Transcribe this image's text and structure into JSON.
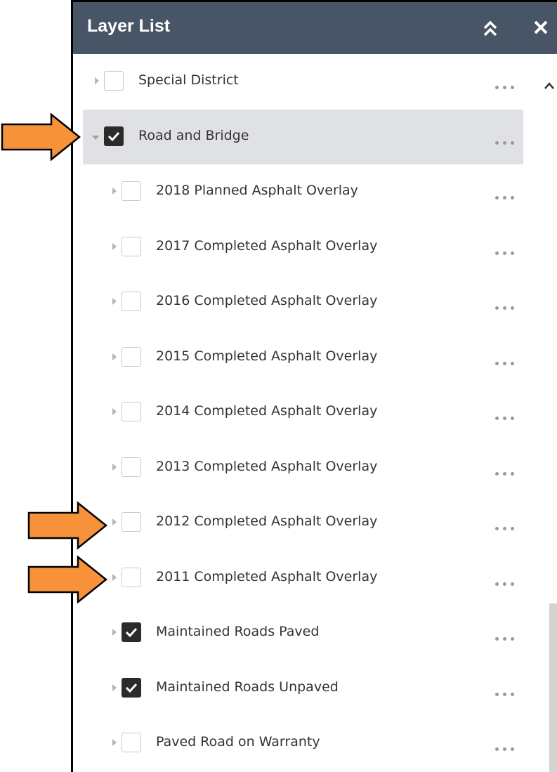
{
  "panel": {
    "title": "Layer List",
    "collapse_icon": "double-chevron-up-icon",
    "close_icon": "close-icon"
  },
  "layers": [
    {
      "label": "Special District",
      "checked": false,
      "expanded": false,
      "level": 0
    },
    {
      "label": "Road and Bridge",
      "checked": true,
      "expanded": true,
      "level": 0,
      "selected": true
    },
    {
      "label": "2018 Planned Asphalt Overlay",
      "checked": false,
      "expanded": false,
      "level": 1
    },
    {
      "label": "2017 Completed Asphalt Overlay",
      "checked": false,
      "expanded": false,
      "level": 1
    },
    {
      "label": "2016 Completed Asphalt Overlay",
      "checked": false,
      "expanded": false,
      "level": 1
    },
    {
      "label": "2015 Completed Asphalt Overlay",
      "checked": false,
      "expanded": false,
      "level": 1
    },
    {
      "label": "2014 Completed Asphalt Overlay",
      "checked": false,
      "expanded": false,
      "level": 1
    },
    {
      "label": "2013 Completed Asphalt Overlay",
      "checked": false,
      "expanded": false,
      "level": 1
    },
    {
      "label": "2012 Completed Asphalt Overlay",
      "checked": false,
      "expanded": false,
      "level": 1
    },
    {
      "label": "2011 Completed Asphalt Overlay",
      "checked": false,
      "expanded": false,
      "level": 1
    },
    {
      "label": "Maintained Roads Paved",
      "checked": true,
      "expanded": false,
      "level": 1
    },
    {
      "label": "Maintained Roads Unpaved",
      "checked": true,
      "expanded": false,
      "level": 1
    },
    {
      "label": "Paved Road on Warranty",
      "checked": false,
      "expanded": false,
      "level": 1
    }
  ],
  "colors": {
    "header_bg": "#485566",
    "selected_row_bg": "#dfe1e4",
    "checkbox_checked": "#2b2b2b",
    "callout_arrow": "#f7923a"
  }
}
